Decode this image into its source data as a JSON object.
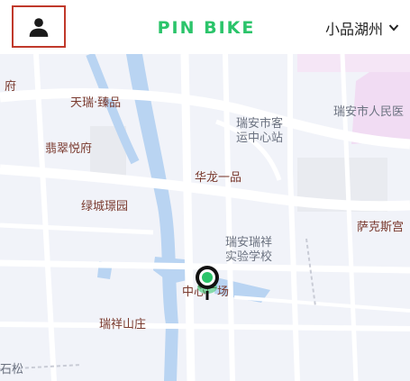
{
  "header": {
    "logo_text": "PIN BIKE",
    "city_label": "小品湖州",
    "icons": {
      "profile": "person-icon",
      "dropdown": "chevron-down-icon"
    }
  },
  "colors": {
    "brand": "#2bc46a",
    "profile_border": "#c0392b",
    "water": "#b9d4f2",
    "park": "#f1dcf3",
    "poi_text": "#7a3a2e"
  },
  "map": {
    "pois": [
      {
        "id": "fu",
        "text": "府"
      },
      {
        "id": "tianrui",
        "text": "天瑞·臻品"
      },
      {
        "id": "feicui",
        "text": "翡翠悦府"
      },
      {
        "id": "keyun1",
        "text": "瑞安市客"
      },
      {
        "id": "keyun2",
        "text": "运中心站"
      },
      {
        "id": "hospital",
        "text": "瑞安市人民医"
      },
      {
        "id": "hualong",
        "text": "华龙一品"
      },
      {
        "id": "lvcheng",
        "text": "绿城璟园"
      },
      {
        "id": "sakesi",
        "text": "萨克斯宫"
      },
      {
        "id": "school1",
        "text": "瑞安瑞祥"
      },
      {
        "id": "school2",
        "text": "实验学校"
      },
      {
        "id": "zhongxin",
        "text": "中心广场"
      },
      {
        "id": "ruixiang",
        "text": "瑞祥山庄"
      },
      {
        "id": "song",
        "text": "石松"
      }
    ],
    "pin_icon": "location-pin-icon"
  }
}
